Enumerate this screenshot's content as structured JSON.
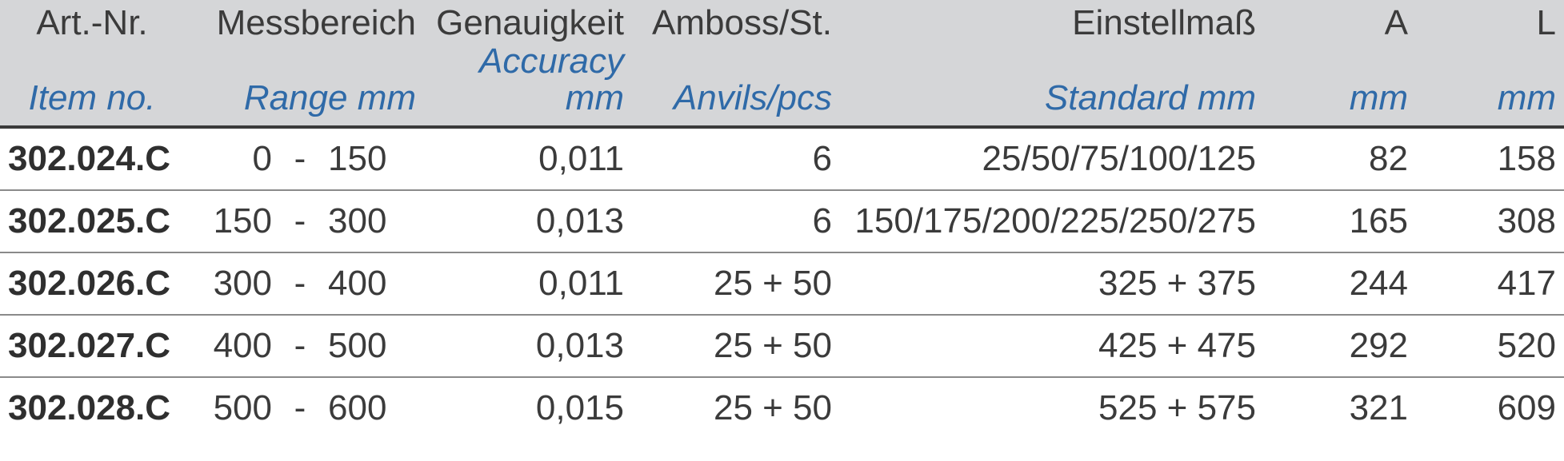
{
  "chart_data": {
    "type": "table",
    "title": "",
    "columns": [
      {
        "de": "Art.-Nr.",
        "en": "Item no."
      },
      {
        "de": "Messbereich",
        "en": "Range mm"
      },
      {
        "de": "Genauigkeit",
        "en": "Accuracy mm"
      },
      {
        "de": "Amboss/St.",
        "en": "Anvils/pcs"
      },
      {
        "de": "Einstellmaß",
        "en": "Standard mm"
      },
      {
        "de": "A",
        "en": "mm"
      },
      {
        "de": "L",
        "en": "mm"
      }
    ],
    "rows": [
      {
        "item": "302.024.C",
        "range_from": "0",
        "range_dash": "-",
        "range_to": "150",
        "accuracy": "0,011",
        "anvils": "6",
        "standard": "25/50/75/100/125",
        "a": "82",
        "l": "158"
      },
      {
        "item": "302.025.C",
        "range_from": "150",
        "range_dash": "-",
        "range_to": "300",
        "accuracy": "0,013",
        "anvils": "6",
        "standard": "150/175/200/225/250/275",
        "a": "165",
        "l": "308"
      },
      {
        "item": "302.026.C",
        "range_from": "300",
        "range_dash": "-",
        "range_to": "400",
        "accuracy": "0,011",
        "anvils": "25 + 50",
        "standard": "325   +   375",
        "a": "244",
        "l": "417"
      },
      {
        "item": "302.027.C",
        "range_from": "400",
        "range_dash": "-",
        "range_to": "500",
        "accuracy": "0,013",
        "anvils": "25 + 50",
        "standard": "425   +   475",
        "a": "292",
        "l": "520"
      },
      {
        "item": "302.028.C",
        "range_from": "500",
        "range_dash": "-",
        "range_to": "600",
        "accuracy": "0,015",
        "anvils": "25 + 50",
        "standard": "525   +   575",
        "a": "321",
        "l": "609"
      }
    ]
  }
}
